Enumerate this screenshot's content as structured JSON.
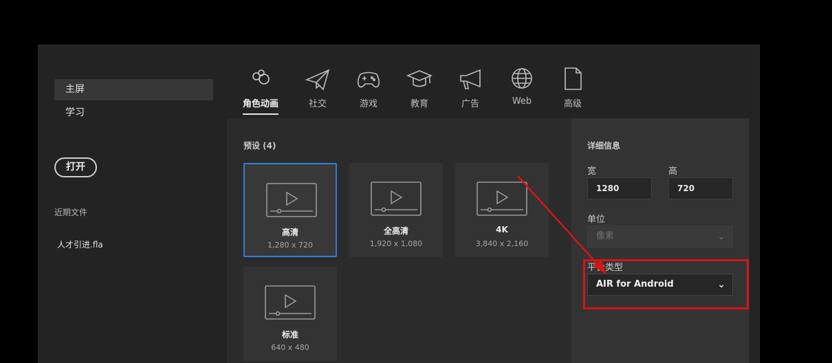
{
  "sidebar": {
    "items": [
      {
        "label": "主屏",
        "active": true
      },
      {
        "label": "学习",
        "active": false
      }
    ],
    "open_button": "打开",
    "recent_title": "近期文件",
    "recent_files": [
      "人才引进.fla"
    ]
  },
  "categories": [
    {
      "label": "角色动画",
      "icon": "character-animation-icon",
      "active": true
    },
    {
      "label": "社交",
      "icon": "paper-plane-icon",
      "active": false
    },
    {
      "label": "游戏",
      "icon": "gamepad-icon",
      "active": false
    },
    {
      "label": "教育",
      "icon": "graduation-cap-icon",
      "active": false
    },
    {
      "label": "广告",
      "icon": "megaphone-icon",
      "active": false
    },
    {
      "label": "Web",
      "icon": "globe-icon",
      "active": false
    },
    {
      "label": "高级",
      "icon": "document-icon",
      "active": false
    }
  ],
  "presets": {
    "title": "预设 (4)",
    "items": [
      {
        "name": "高清",
        "size": "1,280 x 720",
        "selected": true
      },
      {
        "name": "全高清",
        "size": "1,920 x 1,080",
        "selected": false
      },
      {
        "name": "4K",
        "size": "3,840 x 2,160",
        "selected": false
      },
      {
        "name": "标准",
        "size": "640 x 480",
        "selected": false
      }
    ]
  },
  "details": {
    "title": "详细信息",
    "width_label": "宽",
    "width_value": "1280",
    "height_label": "高",
    "height_value": "720",
    "unit_label": "单位",
    "unit_value": "像素",
    "platform_label": "平台类型",
    "platform_value": "AIR for Android"
  },
  "colors": {
    "accent_selected": "#2f7fd4",
    "annotation_red": "#d41616"
  }
}
